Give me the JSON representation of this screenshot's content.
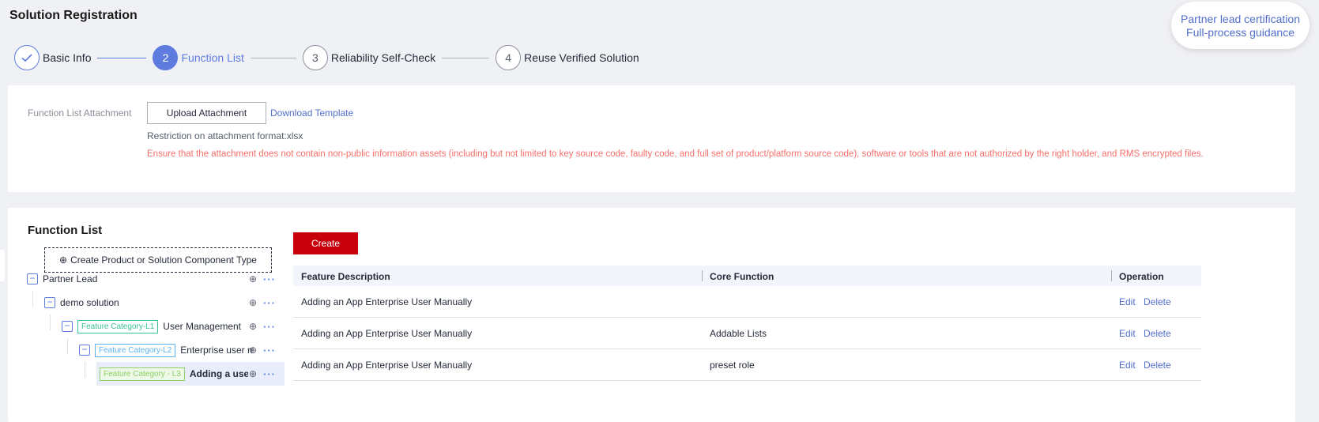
{
  "page_title": "Solution Registration",
  "help_bubble": {
    "line1": "Partner lead certification",
    "line2": "Full-process guidance"
  },
  "steps": [
    {
      "label": "Basic Info",
      "status": "done",
      "icon": "check-icon"
    },
    {
      "number": "2",
      "label": "Function List",
      "status": "active"
    },
    {
      "number": "3",
      "label": "Reliability Self-Check",
      "status": "todo"
    },
    {
      "number": "4",
      "label": "Reuse Verified Solution",
      "status": "todo"
    }
  ],
  "attachment": {
    "label": "Function List Attachment",
    "upload_label": "Upload Attachment",
    "download_label": "Download Template",
    "restriction": "Restriction on attachment format:xlsx",
    "warning": "Ensure that the attachment does not contain non-public information assets (including but not limited to key source code, faulty code, and full set of product/platform source code), software or tools that are not authorized by the right holder, and RMS encrypted files."
  },
  "function_list": {
    "title": "Function List",
    "create_type_label": "Create Product or Solution Component Type",
    "create_label": "Create",
    "tree": [
      {
        "text": "Partner Lead",
        "toggle": "−"
      },
      {
        "text": "demo solution",
        "toggle": "−"
      },
      {
        "tag": "Feature Category-L1",
        "text": "User Management",
        "toggle": "−"
      },
      {
        "tag": "Feature Category-L2",
        "text": "Enterprise user ma...",
        "toggle": "−"
      },
      {
        "tag": "Feature Category - L3",
        "text": "Adding a user"
      }
    ],
    "columns": [
      "Feature Description",
      "Core Function",
      "Operation"
    ],
    "rows": [
      {
        "feature": "Adding an App Enterprise User Manually",
        "core": "",
        "edit": "Edit",
        "delete": "Delete"
      },
      {
        "feature": "Adding an App Enterprise User Manually",
        "core": "Addable Lists",
        "edit": "Edit",
        "delete": "Delete"
      },
      {
        "feature": "Adding an App Enterprise User Manually",
        "core": "preset role",
        "edit": "Edit",
        "delete": "Delete"
      }
    ]
  },
  "colors": {
    "primary": "#5e7ce0",
    "danger": "#c7000b",
    "warning_text": "#f66f6a",
    "link": "#526ecc"
  }
}
